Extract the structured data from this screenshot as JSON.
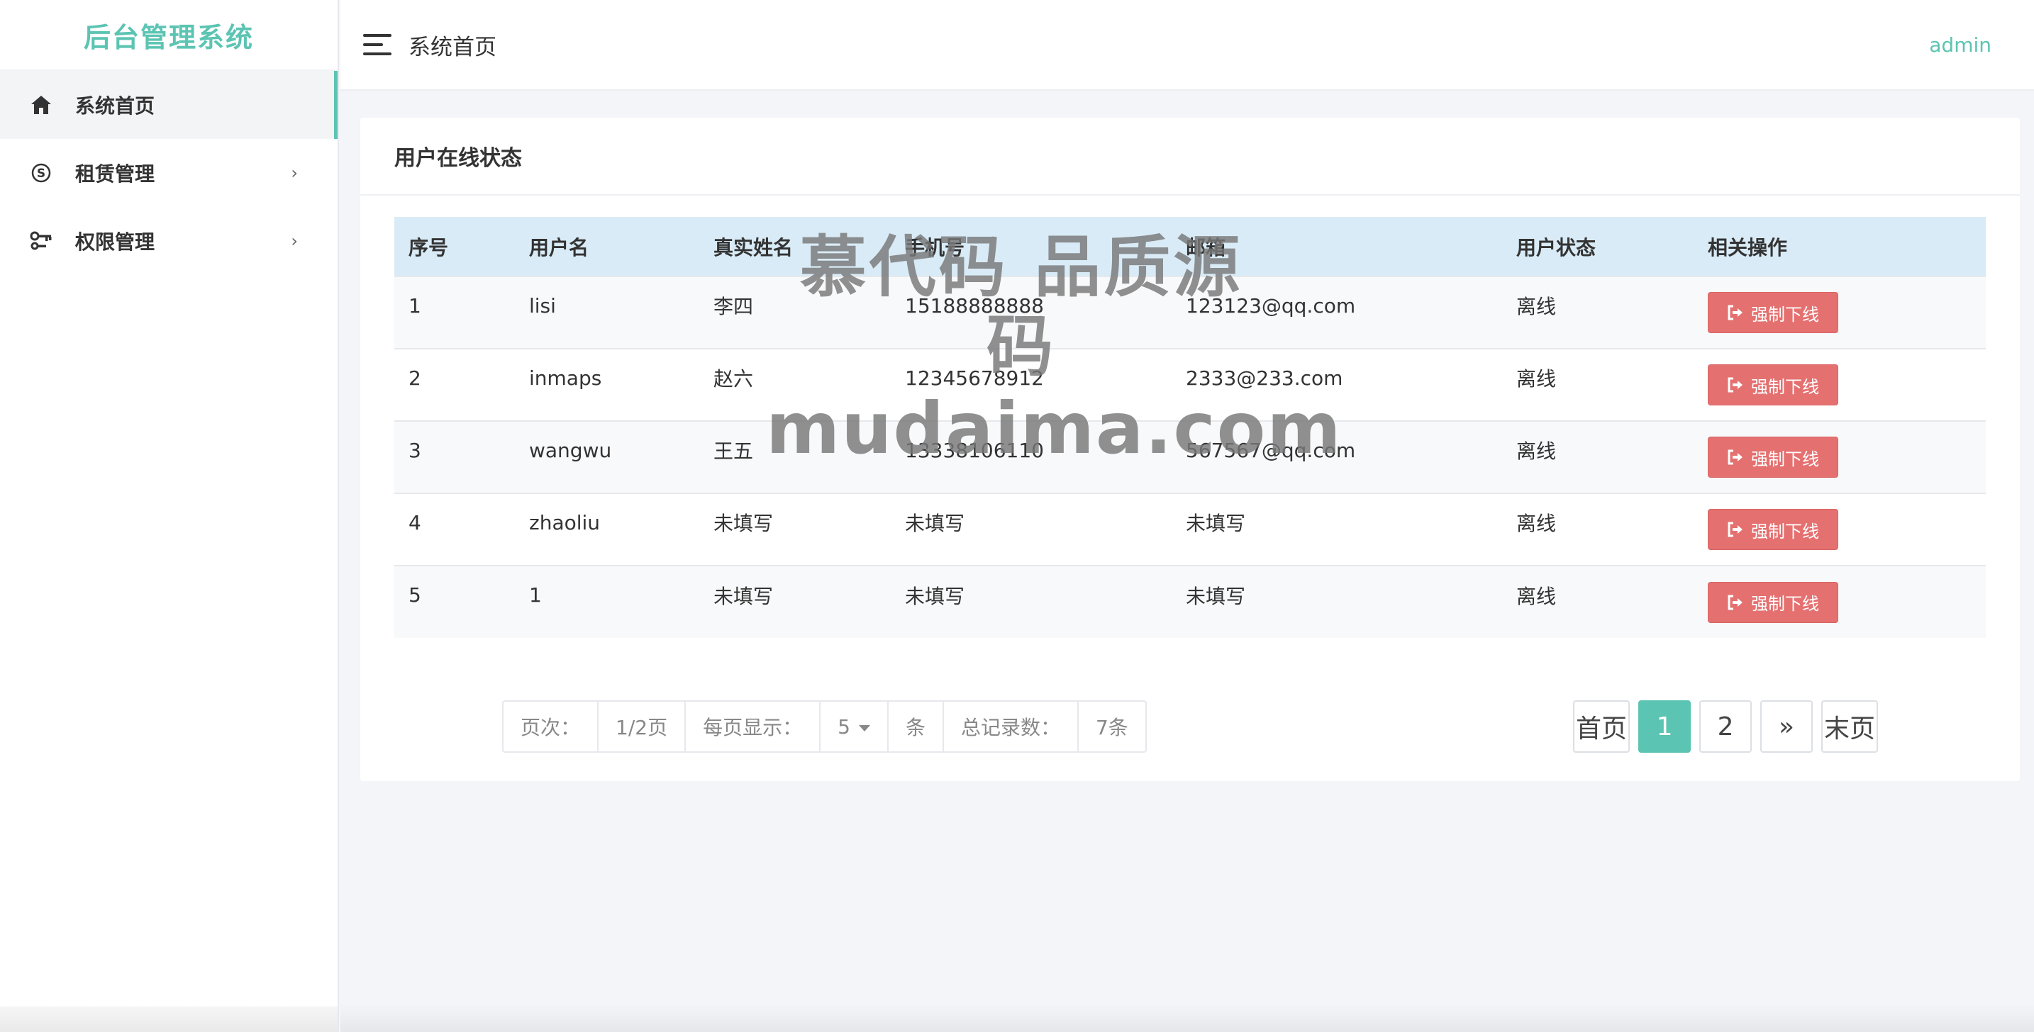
{
  "sidebar": {
    "brand": "后台管理系统",
    "items": [
      {
        "label": "系统首页",
        "icon": "home-icon",
        "active": true
      },
      {
        "label": "租赁管理",
        "icon": "skype-icon",
        "arrow": "›"
      },
      {
        "label": "权限管理",
        "icon": "key-icon",
        "arrow": "›"
      }
    ]
  },
  "header": {
    "title": "系统首页",
    "user": "admin"
  },
  "card": {
    "title": "用户在线状态"
  },
  "table": {
    "columns": [
      "序号",
      "用户名",
      "真实姓名",
      "手机号",
      "邮箱",
      "用户状态",
      "相关操作"
    ],
    "action_label": "强制下线",
    "rows": [
      {
        "id": "1",
        "username": "lisi",
        "realname": "李四",
        "phone": "15188888888",
        "email": "123123@qq.com",
        "status": "离线"
      },
      {
        "id": "2",
        "username": "inmaps",
        "realname": "赵六",
        "phone": "12345678912",
        "email": "2333@233.com",
        "status": "离线"
      },
      {
        "id": "3",
        "username": "wangwu",
        "realname": "王五",
        "phone": "13338106110",
        "email": "567567@qq.com",
        "status": "离线"
      },
      {
        "id": "4",
        "username": "zhaoliu",
        "realname": "未填写",
        "phone": "未填写",
        "email": "未填写",
        "status": "离线"
      },
      {
        "id": "5",
        "username": "1",
        "realname": "未填写",
        "phone": "未填写",
        "email": "未填写",
        "status": "离线"
      }
    ]
  },
  "pagination_info": {
    "page_label": "页次：",
    "page_value": "1/2页",
    "per_page_label": "每页显示：",
    "per_page_value": "5",
    "unit": "条",
    "total_label": "总记录数：",
    "total_value": "7条"
  },
  "pager": {
    "first": "首页",
    "pages": [
      "1",
      "2"
    ],
    "current": "1",
    "next": "»",
    "last": "末页"
  },
  "watermark": {
    "line1": "慕代码 品质源码",
    "line2": "mudaima.com"
  },
  "colors": {
    "accent": "#5cc4b2",
    "danger": "#e57070",
    "table_header": "#d9ebf6"
  }
}
